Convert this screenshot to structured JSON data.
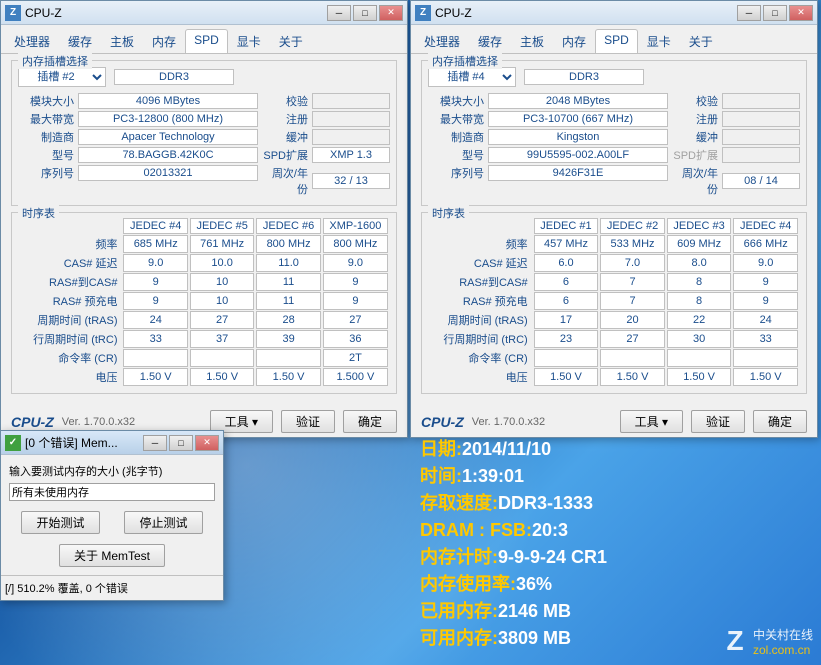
{
  "app_title": "CPU-Z",
  "tabs": [
    "处理器",
    "缓存",
    "主板",
    "内存",
    "SPD",
    "显卡",
    "关于"
  ],
  "active_tab": "SPD",
  "slot_group_title": "内存插槽选择",
  "timing_group_title": "时序表",
  "field_labels": {
    "module_size": "模块大小",
    "max_bandwidth": "最大带宽",
    "manufacturer": "制造商",
    "part_number": "型号",
    "serial": "序列号",
    "correction": "校验",
    "registered": "注册",
    "buffered": "缓冲",
    "spd_ext": "SPD扩展",
    "week_year": "周次/年份"
  },
  "timing_row_labels": [
    "频率",
    "CAS# 延迟",
    "RAS#到CAS#",
    "RAS# 预充电",
    "周期时间 (tRAS)",
    "行周期时间 (tRC)",
    "命令率 (CR)",
    "电压"
  ],
  "left": {
    "slot": "插槽 #2",
    "mem_type": "DDR3",
    "module_size": "4096 MBytes",
    "max_bandwidth": "PC3-12800 (800 MHz)",
    "manufacturer": "Apacer Technology",
    "part_number": "78.BAGGB.42K0C",
    "serial": "02013321",
    "spd_ext": "XMP 1.3",
    "week_year": "32 / 13",
    "timing_headers": [
      "JEDEC #4",
      "JEDEC #5",
      "JEDEC #6",
      "XMP-1600"
    ],
    "timings": [
      [
        "685 MHz",
        "761 MHz",
        "800 MHz",
        "800 MHz"
      ],
      [
        "9.0",
        "10.0",
        "11.0",
        "9.0"
      ],
      [
        "9",
        "10",
        "11",
        "9"
      ],
      [
        "9",
        "10",
        "11",
        "9"
      ],
      [
        "24",
        "27",
        "28",
        "27"
      ],
      [
        "33",
        "37",
        "39",
        "36"
      ],
      [
        "",
        "",
        "",
        "2T"
      ],
      [
        "1.50 V",
        "1.50 V",
        "1.50 V",
        "1.500 V"
      ]
    ]
  },
  "right": {
    "slot": "插槽 #4",
    "mem_type": "DDR3",
    "module_size": "2048 MBytes",
    "max_bandwidth": "PC3-10700 (667 MHz)",
    "manufacturer": "Kingston",
    "part_number": "99U5595-002.A00LF",
    "serial": "9426F31E",
    "spd_ext": "",
    "week_year": "08 / 14",
    "timing_headers": [
      "JEDEC #1",
      "JEDEC #2",
      "JEDEC #3",
      "JEDEC #4"
    ],
    "timings": [
      [
        "457 MHz",
        "533 MHz",
        "609 MHz",
        "666 MHz"
      ],
      [
        "6.0",
        "7.0",
        "8.0",
        "9.0"
      ],
      [
        "6",
        "7",
        "8",
        "9"
      ],
      [
        "6",
        "7",
        "8",
        "9"
      ],
      [
        "17",
        "20",
        "22",
        "24"
      ],
      [
        "23",
        "27",
        "30",
        "33"
      ],
      [
        "",
        "",
        "",
        ""
      ],
      [
        "1.50 V",
        "1.50 V",
        "1.50 V",
        "1.50 V"
      ]
    ]
  },
  "bottom": {
    "version": "Ver. 1.70.0.x32",
    "tools": "工具",
    "validate": "验证",
    "ok": "确定"
  },
  "memtest": {
    "title": "[0 个错误] Mem...",
    "prompt": "输入要测试内存的大小 (兆字节)",
    "input_value": "所有未使用内存",
    "start": "开始测试",
    "stop": "停止测试",
    "about": "关于 MemTest",
    "status": "[/]  510.2% 覆盖, 0 个错误"
  },
  "overlay": {
    "date_l": "日期: ",
    "date_v": "2014/11/10",
    "time_l": "时间: ",
    "time_v": "1:39:01",
    "speed_l": "存取速度: ",
    "speed_v": "DDR3-1333",
    "dram_l": "DRAM : FSB: ",
    "dram_v": "20:3",
    "timing_l": "内存计时: ",
    "timing_v": "9-9-9-24 CR1",
    "usage_l": "内存使用率: ",
    "usage_v": "36%",
    "used_l": "已用内存: ",
    "used_v": "2146 MB",
    "avail_l": "可用内存: ",
    "avail_v": "3809 MB"
  },
  "watermark": {
    "cn": "中关村在线",
    "url": "zol.com.cn"
  }
}
